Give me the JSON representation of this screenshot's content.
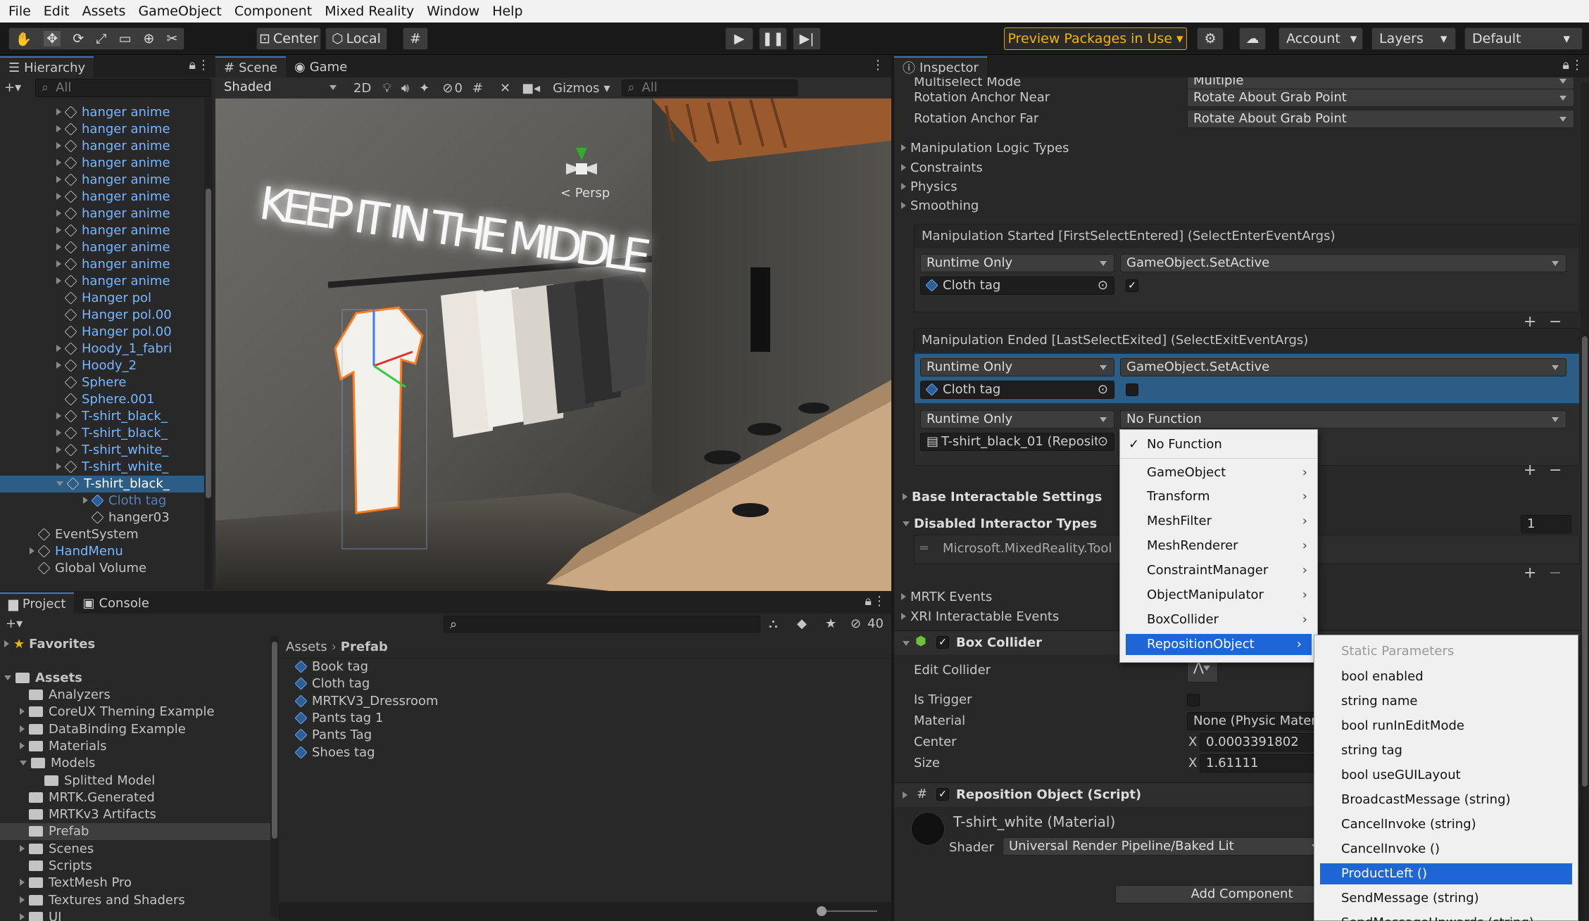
{
  "menubar": [
    "File",
    "Edit",
    "Assets",
    "GameObject",
    "Component",
    "Mixed Reality",
    "Window",
    "Help"
  ],
  "toolbar": {
    "center": "Center",
    "local": "Local",
    "preview": "Preview Packages in Use",
    "account": "Account",
    "layers": "Layers",
    "layout": "Default"
  },
  "hierarchy": {
    "title": "Hierarchy",
    "search": "All",
    "items": [
      {
        "label": "hanger anime",
        "blue": true,
        "indent": 2,
        "arrow": true
      },
      {
        "label": "hanger anime",
        "blue": true,
        "indent": 2,
        "arrow": true
      },
      {
        "label": "hanger anime",
        "blue": true,
        "indent": 2,
        "arrow": true
      },
      {
        "label": "hanger anime",
        "blue": true,
        "indent": 2,
        "arrow": true
      },
      {
        "label": "hanger anime",
        "blue": true,
        "indent": 2,
        "arrow": true
      },
      {
        "label": "hanger anime",
        "blue": true,
        "indent": 2,
        "arrow": true
      },
      {
        "label": "hanger anime",
        "blue": true,
        "indent": 2,
        "arrow": true
      },
      {
        "label": "hanger anime",
        "blue": true,
        "indent": 2,
        "arrow": true
      },
      {
        "label": "hanger anime",
        "blue": true,
        "indent": 2,
        "arrow": true
      },
      {
        "label": "hanger anime",
        "blue": true,
        "indent": 2,
        "arrow": true
      },
      {
        "label": "hanger anime",
        "blue": true,
        "indent": 2,
        "arrow": true
      },
      {
        "label": "Hanger pol",
        "blue": true,
        "indent": 2,
        "arrow": false
      },
      {
        "label": "Hanger pol.00",
        "blue": true,
        "indent": 2,
        "arrow": false
      },
      {
        "label": "Hanger pol.00",
        "blue": true,
        "indent": 2,
        "arrow": false
      },
      {
        "label": "Hoody_1_fabri",
        "blue": true,
        "indent": 2,
        "arrow": true
      },
      {
        "label": "Hoody_2",
        "blue": true,
        "indent": 2,
        "arrow": true
      },
      {
        "label": "Sphere",
        "blue": true,
        "indent": 2,
        "arrow": false
      },
      {
        "label": "Sphere.001",
        "blue": true,
        "indent": 2,
        "arrow": false
      },
      {
        "label": "T-shirt_black_",
        "blue": true,
        "indent": 2,
        "arrow": true
      },
      {
        "label": "T-shirt_black_",
        "blue": true,
        "indent": 2,
        "arrow": true
      },
      {
        "label": "T-shirt_white_",
        "blue": true,
        "indent": 2,
        "arrow": true
      },
      {
        "label": "T-shirt_white_",
        "blue": true,
        "indent": 2,
        "arrow": true
      },
      {
        "label": "T-shirt_black_",
        "blue": false,
        "indent": 2,
        "arrow": true,
        "selected": true
      },
      {
        "label": "Cloth tag",
        "blue": true,
        "indent": 3,
        "arrow": true,
        "dim": true
      },
      {
        "label": "hanger03",
        "blue": false,
        "indent": 3,
        "arrow": false
      },
      {
        "label": "EventSystem",
        "blue": false,
        "indent": 1,
        "arrow": false
      },
      {
        "label": "HandMenu",
        "blue": true,
        "indent": 1,
        "arrow": true
      },
      {
        "label": "Global Volume",
        "blue": false,
        "indent": 1,
        "arrow": false
      }
    ]
  },
  "scene": {
    "tab_scene": "Scene",
    "tab_game": "Game",
    "shading": "Shaded",
    "mode2d": "2D",
    "hidden_count": "0",
    "gizmos": "Gizmos",
    "search": "All",
    "persp": "< Persp",
    "neon_text": "KEEP IT IN THE MIDDLE"
  },
  "project": {
    "tab_project": "Project",
    "tab_console": "Console",
    "hidden_count": "40",
    "favorites": "Favorites",
    "assets_root": "Assets",
    "tree": [
      {
        "label": "Analyzers",
        "indent": 1,
        "arrow": false
      },
      {
        "label": "CoreUX Theming Example",
        "indent": 1,
        "arrow": true
      },
      {
        "label": "DataBinding Example",
        "indent": 1,
        "arrow": true
      },
      {
        "label": "Materials",
        "indent": 1,
        "arrow": true
      },
      {
        "label": "Models",
        "indent": 1,
        "arrow": "down"
      },
      {
        "label": "Splitted Model",
        "indent": 2,
        "arrow": false
      },
      {
        "label": "MRTK.Generated",
        "indent": 1,
        "arrow": false
      },
      {
        "label": "MRTKv3 Artifacts",
        "indent": 1,
        "arrow": false
      },
      {
        "label": "Prefab",
        "indent": 1,
        "arrow": false,
        "selected": true
      },
      {
        "label": "Scenes",
        "indent": 1,
        "arrow": true
      },
      {
        "label": "Scripts",
        "indent": 1,
        "arrow": false
      },
      {
        "label": "TextMesh Pro",
        "indent": 1,
        "arrow": true
      },
      {
        "label": "Textures and Shaders",
        "indent": 1,
        "arrow": true
      },
      {
        "label": "UI",
        "indent": 1,
        "arrow": true
      }
    ],
    "breadcrumb": [
      "Assets",
      "Prefab"
    ],
    "files": [
      "Book tag",
      "Cloth tag",
      "MRTKV3_Dressroom",
      "Pants tag 1",
      "Pants Tag",
      "Shoes tag"
    ]
  },
  "inspector": {
    "title": "Inspector",
    "multiselect_label": "Multiselect Mode",
    "multiselect_value": "Multiple",
    "rot_near_label": "Rotation Anchor Near",
    "rot_near_value": "Rotate About Grab Point",
    "rot_far_label": "Rotation Anchor Far",
    "rot_far_value": "Rotate About Grab Point",
    "foldouts": [
      "Manipulation Logic Types",
      "Constraints",
      "Physics",
      "Smoothing"
    ],
    "event1": {
      "header": "Manipulation Started [FirstSelectEntered] (SelectEnterEventArgs)",
      "runtime": "Runtime Only",
      "function": "GameObject.SetActive",
      "object": "Cloth tag"
    },
    "event2": {
      "header": "Manipulation Ended [LastSelectExited] (SelectExitEventArgs)",
      "runtime": "Runtime Only",
      "function": "GameObject.SetActive",
      "object": "Cloth tag",
      "runtime2": "Runtime Only",
      "function2": "No Function",
      "object2": "T-shirt_black_01 (Repositi"
    },
    "base_settings": "Base Interactable Settings",
    "disabled_types": "Disabled Interactor Types",
    "disabled_count": "1",
    "disabled_item": "Microsoft.MixedReality.Tool",
    "mrtk_events": "MRTK Events",
    "xri_events": "XRI Interactable Events",
    "box_collider": "Box Collider",
    "edit_collider": "Edit Collider",
    "is_trigger": "Is Trigger",
    "material_label": "Material",
    "material_value": "None (Physic Materi",
    "center_label": "Center",
    "center_x": "0.0003391802",
    "size_label": "Size",
    "size_x": "1.61111",
    "reposition": "Reposition Object (Script)",
    "mat_name": "T-shirt_white (Material)",
    "shader_label": "Shader",
    "shader_value": "Universal Render Pipeline/Baked Lit",
    "add_component": "Add Component"
  },
  "menu1": {
    "items": [
      "No Function",
      "GameObject",
      "Transform",
      "MeshFilter",
      "MeshRenderer",
      "ConstraintManager",
      "ObjectManipulator",
      "BoxCollider",
      "RepositionObject"
    ]
  },
  "menu2": {
    "header": "Static Parameters",
    "items": [
      "bool enabled",
      "string name",
      "bool runInEditMode",
      "string tag",
      "bool useGUILayout",
      "BroadcastMessage (string)",
      "CancelInvoke (string)",
      "CancelInvoke ()",
      "ProductLeft ()",
      "SendMessage (string)",
      "SendMessageUpwards (string)"
    ]
  }
}
